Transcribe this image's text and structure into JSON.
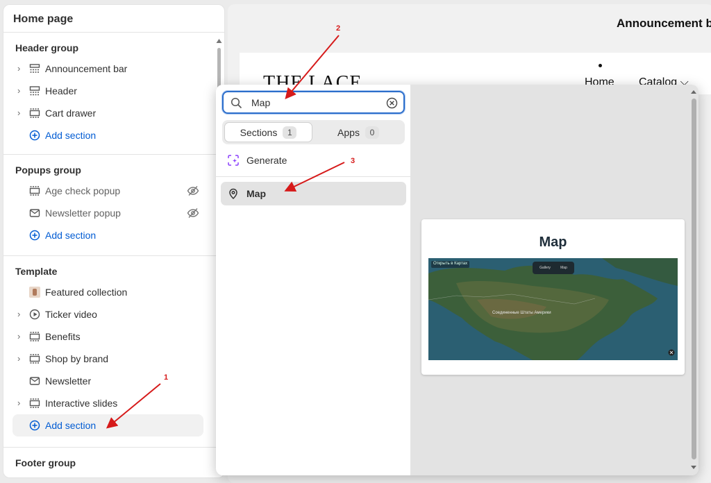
{
  "sidebar": {
    "title": "Home page",
    "header_group": {
      "title": "Header group",
      "items": [
        {
          "label": "Announcement bar",
          "icon": "section-icon"
        },
        {
          "label": "Header",
          "icon": "header-icon"
        },
        {
          "label": "Cart drawer",
          "icon": "section-icon"
        }
      ],
      "add_label": "Add section"
    },
    "popups_group": {
      "title": "Popups group",
      "items": [
        {
          "label": "Age check popup",
          "icon": "section-icon",
          "hidden": true
        },
        {
          "label": "Newsletter popup",
          "icon": "mail-icon",
          "hidden": true
        }
      ],
      "add_label": "Add section"
    },
    "template": {
      "title": "Template",
      "items": [
        {
          "label": "Featured collection",
          "icon": "product-thumbnail"
        },
        {
          "label": "Ticker video",
          "icon": "play-icon"
        },
        {
          "label": "Benefits",
          "icon": "section-icon"
        },
        {
          "label": "Shop by brand",
          "icon": "section-icon"
        },
        {
          "label": "Newsletter",
          "icon": "mail-icon"
        },
        {
          "label": "Interactive slides",
          "icon": "section-icon"
        }
      ],
      "add_label": "Add section"
    },
    "footer_group": {
      "title": "Footer group"
    }
  },
  "preview": {
    "announcement": "Announcement b",
    "logo": "THE LACE",
    "nav": [
      "Home",
      "Catalog"
    ]
  },
  "popup": {
    "search": {
      "value": "Map"
    },
    "tabs": [
      {
        "label": "Sections",
        "count": "1"
      },
      {
        "label": "Apps",
        "count": "0"
      }
    ],
    "generate_label": "Generate",
    "result_label": "Map",
    "preview_card": {
      "title": "Map",
      "map_badge": "Открыть в Картах",
      "toggle": [
        "Gallery",
        "Map"
      ],
      "map_label": "Соединенные Штаты Америки"
    }
  },
  "annotations": [
    "1",
    "2",
    "3"
  ],
  "colors": {
    "accent": "#005bd3",
    "focus": "#2c6ecb",
    "annotation": "#d61a1a"
  }
}
